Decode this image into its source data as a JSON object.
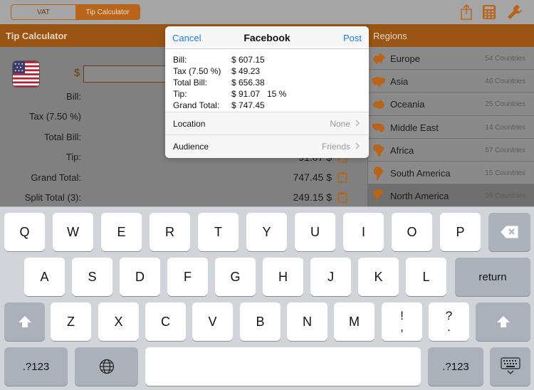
{
  "top_bar": {
    "tabs": [
      {
        "label": "VAT",
        "selected": false
      },
      {
        "label": "Tip Calculator",
        "selected": true
      }
    ],
    "icons": [
      "share-icon",
      "calculator-icon",
      "wrench-icon"
    ]
  },
  "tip_panel": {
    "title": "Tip Calculator",
    "currency_symbol": "$",
    "bill_input_value": "",
    "rows": [
      {
        "label": "Bill:",
        "value": ""
      },
      {
        "label": "Tax (7.50 %)",
        "value": ""
      },
      {
        "label": "Total Bill:",
        "value": ""
      },
      {
        "label": "Tip:",
        "value": "91.07 $"
      },
      {
        "label": "Grand Total:",
        "value": "747.45 $"
      },
      {
        "label": "Split Total (3):",
        "value": "249.15 $"
      }
    ]
  },
  "regions": {
    "title": "Regions",
    "items": [
      {
        "name": "Europe",
        "count": "54 Countries"
      },
      {
        "name": "Asia",
        "count": "40 Countries"
      },
      {
        "name": "Oceania",
        "count": "25 Countries"
      },
      {
        "name": "Middle East",
        "count": "14 Countries"
      },
      {
        "name": "Africa",
        "count": "57 Countries"
      },
      {
        "name": "South America",
        "count": "15 Countries"
      },
      {
        "name": "North America",
        "count": "36 Countries",
        "selected": true
      }
    ]
  },
  "share_sheet": {
    "cancel_label": "Cancel",
    "title": "Facebook",
    "post_label": "Post",
    "lines": [
      {
        "label": "Bill:",
        "value": "$ 607.15"
      },
      {
        "label": "Tax (7.50 %)",
        "value": "$ 49.23"
      },
      {
        "label": "Total Bill:",
        "value": "$ 656.38"
      },
      {
        "label": "Tip:",
        "value": "$ 91.07",
        "extra": "15 %"
      },
      {
        "label": "Grand Total:",
        "value": "$ 747.45"
      }
    ],
    "location": {
      "label": "Location",
      "value": "None"
    },
    "audience": {
      "label": "Audience",
      "value": "Friends"
    }
  },
  "keyboard": {
    "row1": [
      "Q",
      "W",
      "E",
      "R",
      "T",
      "Y",
      "U",
      "I",
      "O",
      "P"
    ],
    "row2": [
      "A",
      "S",
      "D",
      "F",
      "G",
      "H",
      "J",
      "K",
      "L"
    ],
    "row3": [
      "Z",
      "X",
      "C",
      "V",
      "B",
      "N",
      "M"
    ],
    "punct1": {
      "top": "!",
      "bottom": ","
    },
    "punct2": {
      "top": "?",
      "bottom": "."
    },
    "return_label": "return",
    "numbers_label": ".?123",
    "space_label": ""
  },
  "colors": {
    "accent": "#b8641a",
    "link": "#1a7cf2"
  }
}
